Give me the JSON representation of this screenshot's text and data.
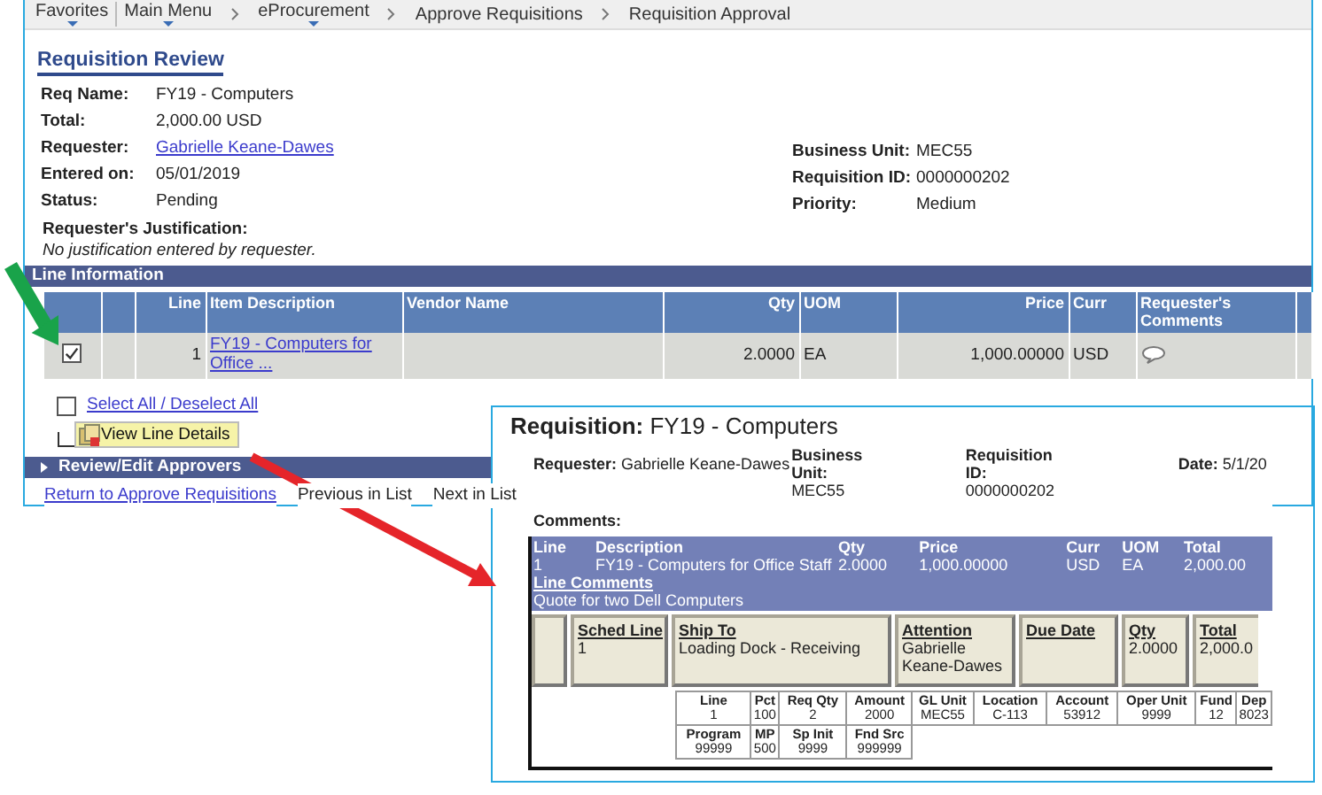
{
  "breadcrumb": [
    {
      "label": "Favorites",
      "menu": true
    },
    {
      "label": "Main Menu",
      "menu": true
    },
    {
      "label": "eProcurement",
      "menu": true
    },
    {
      "label": "Approve Requisitions",
      "menu": false
    },
    {
      "label": "Requisition Approval",
      "menu": false
    }
  ],
  "page_title": "Requisition Review",
  "summary_fields": [
    {
      "label": "Req Name:",
      "value": "FY19 - Computers",
      "kind": "text"
    },
    {
      "label": "Total:",
      "value": "2,000.00 USD",
      "kind": "text"
    },
    {
      "label": "Requester:",
      "value": "Gabrielle Keane-Dawes",
      "kind": "link"
    },
    {
      "label": "Entered on:",
      "value": "05/01/2019",
      "kind": "text"
    },
    {
      "label": "Status:",
      "value": "Pending",
      "kind": "text"
    }
  ],
  "side_fields": [
    {
      "label": "Business Unit:",
      "value": "MEC55"
    },
    {
      "label": "Requisition ID:",
      "value": "0000000202"
    },
    {
      "label": "Priority:",
      "value": "Medium"
    }
  ],
  "justification": {
    "label": "Requester's Justification:",
    "value": "No justification entered by requester."
  },
  "line_information": {
    "title": "Line Information",
    "columns": [
      "Line",
      "Item Description",
      "Vendor Name",
      "Qty",
      "UOM",
      "Price",
      "Curr",
      "Requester's Comments"
    ],
    "rows": [
      {
        "checked": true,
        "line": "1",
        "item_description": "FY19 - Computers for Office ...",
        "qty": "2.0000",
        "uom": "EA",
        "price": "1,000.00000",
        "curr": "USD",
        "has_comment": true
      }
    ]
  },
  "select_all": {
    "label": "Select All / Deselect All",
    "checked": false
  },
  "view_line_details_button": "View Line Details",
  "approvers_section": {
    "title": "Review/Edit Approvers",
    "expanded": false
  },
  "footer_links": [
    {
      "label": "Return to Approve Requisitions",
      "kind": "link"
    },
    {
      "label": "Previous in List",
      "kind": "text"
    },
    {
      "label": "Next in List",
      "kind": "text"
    }
  ],
  "detail_popup": {
    "title_label": "Requisition:",
    "title_value": "FY19 - Computers",
    "header_fields": [
      {
        "label": "Requester:",
        "value": "Gabrielle Keane-Dawes"
      },
      {
        "label": "Business Unit:",
        "value": "MEC55"
      },
      {
        "label": "Requisition ID:",
        "value": "0000000202"
      },
      {
        "label": "Date:",
        "value": "5/1/20"
      }
    ],
    "comments_label": "Comments:",
    "line_table": {
      "columns": [
        "Line",
        "Description",
        "Qty",
        "Price",
        "Curr",
        "UOM",
        "Total"
      ],
      "row": [
        "1",
        "FY19 - Computers for Office Staff",
        "2.0000",
        "1,000.00000",
        "USD",
        "EA",
        "2,000.00"
      ],
      "comments_label": "Line Comments",
      "comment": "Quote for two Dell Computers"
    },
    "schedule": [
      {
        "heading": "Sched Line",
        "value": "1"
      },
      {
        "heading": "Ship To",
        "value": "Loading Dock - Receiving"
      },
      {
        "heading": "Attention",
        "value": "Gabrielle Keane-Dawes"
      },
      {
        "heading": "Due Date"
      },
      {
        "heading": "Qty",
        "value": "2.0000"
      },
      {
        "heading": "Total",
        "value": "2,000.0"
      }
    ],
    "distribution": [
      [
        {
          "heading": "Line",
          "value": "1"
        },
        {
          "heading": "Pct",
          "value": "100"
        },
        {
          "heading": "Req Qty",
          "value": "2"
        },
        {
          "heading": "Amount",
          "value": "2000"
        },
        {
          "heading": "GL Unit",
          "value": "MEC55"
        },
        {
          "heading": "Location",
          "value": "C-113"
        },
        {
          "heading": "Account",
          "value": "53912"
        },
        {
          "heading": "Oper Unit",
          "value": "9999"
        },
        {
          "heading": "Fund",
          "value": "12"
        },
        {
          "heading": "Dep",
          "value": "8023"
        }
      ],
      [
        {
          "heading": "Program",
          "value": "99999"
        },
        {
          "heading": "MP",
          "value": "500"
        },
        {
          "heading": "Sp Init",
          "value": "9999"
        },
        {
          "heading": "Fnd Src",
          "value": "999999"
        }
      ]
    ]
  }
}
